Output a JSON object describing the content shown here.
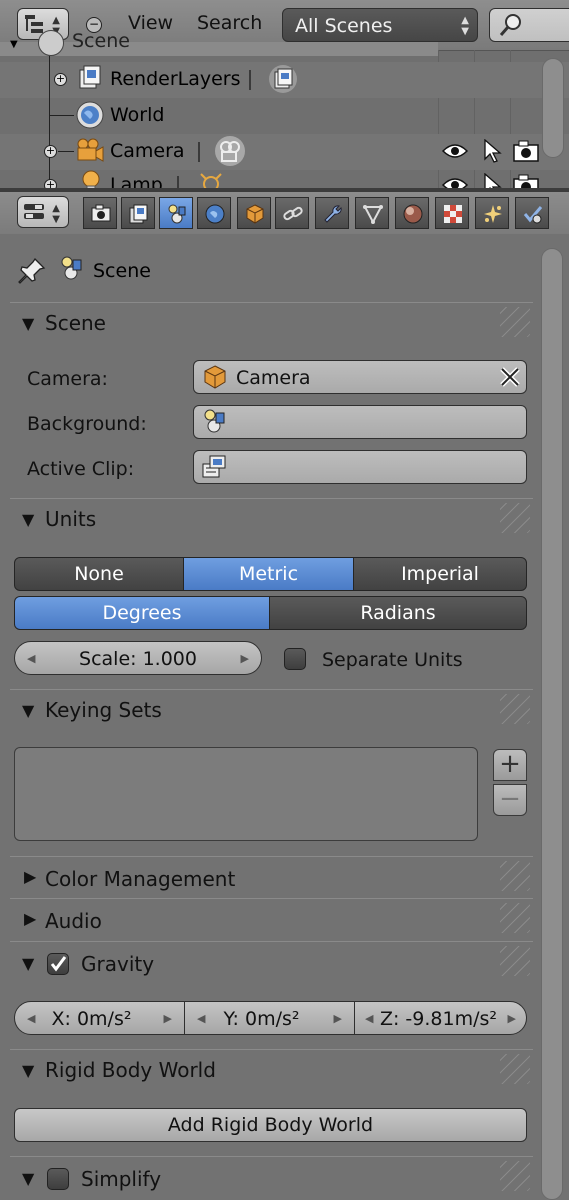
{
  "outliner": {
    "menu_view": "View",
    "menu_search": "Search",
    "display_mode": "All Scenes",
    "search_icon": "search-icon",
    "rows": [
      {
        "label": "Scene",
        "icon": "scene-icon"
      },
      {
        "label": "RenderLayers",
        "icon": "render-layers-icon"
      },
      {
        "label": "World",
        "icon": "world-icon"
      },
      {
        "label": "Camera",
        "icon": "camera-object-icon"
      },
      {
        "label": "Lamp",
        "icon": "lamp-object-icon"
      }
    ]
  },
  "properties": {
    "active_tab": "scene",
    "tabs": [
      "render",
      "render-layers",
      "scene",
      "world",
      "object",
      "constraints",
      "modifiers",
      "data",
      "material",
      "texture",
      "particles",
      "physics"
    ],
    "context_label": "Scene",
    "panels": {
      "scene": {
        "title": "Scene",
        "camera_label": "Camera:",
        "camera_value": "Camera",
        "background_label": "Background:",
        "background_value": "",
        "active_clip_label": "Active Clip:",
        "active_clip_value": ""
      },
      "units": {
        "title": "Units",
        "systems": [
          "None",
          "Metric",
          "Imperial"
        ],
        "selected_system": "Metric",
        "rotation": [
          "Degrees",
          "Radians"
        ],
        "selected_rotation": "Degrees",
        "scale": "Scale: 1.000",
        "separate_units_label": "Separate Units",
        "separate_units_checked": false
      },
      "keying_sets": {
        "title": "Keying Sets",
        "add_symbol": "+",
        "remove_symbol": "−"
      },
      "color_management": {
        "title": "Color Management",
        "expanded": false
      },
      "audio": {
        "title": "Audio",
        "expanded": false
      },
      "gravity": {
        "title": "Gravity",
        "enabled": true,
        "x": "X: 0m/s²",
        "y": "Y: 0m/s²",
        "z": "Z: -9.81m/s²"
      },
      "rigid_body_world": {
        "title": "Rigid Body World",
        "add_button": "Add Rigid Body World"
      },
      "simplify": {
        "title": "Simplify",
        "enabled": false
      }
    }
  },
  "colors": {
    "accent_blue": "#5689d4",
    "panel_bg": "#727272",
    "header_bg": "#808080"
  }
}
